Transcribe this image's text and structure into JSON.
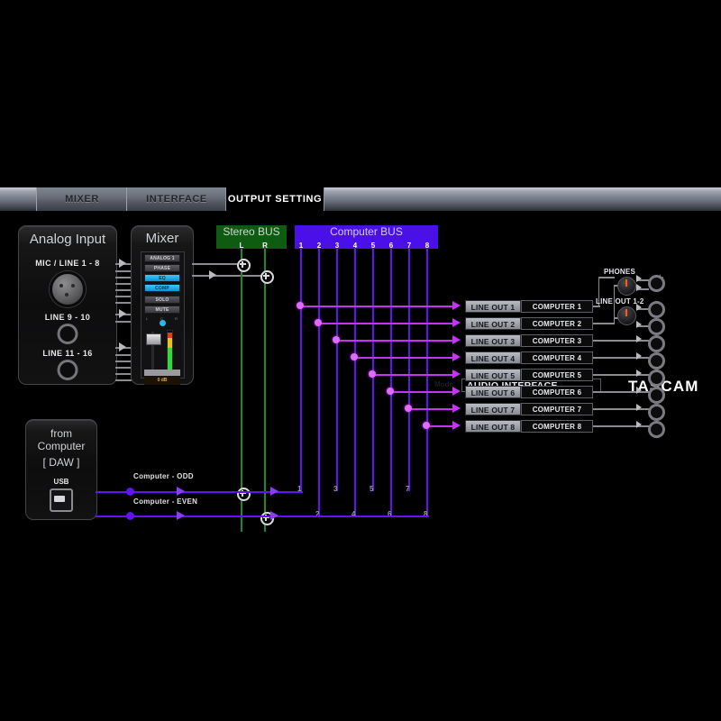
{
  "header": {
    "tabs": [
      {
        "label": "MIXER",
        "active": false
      },
      {
        "label": "INTERFACE",
        "active": false
      },
      {
        "label": "OUTPUT SETTING",
        "active": true
      }
    ],
    "mode_label": "Mode:",
    "mode_value": "AUDIO INTERFACE",
    "brand": "TASCAM"
  },
  "analog_input": {
    "title": "Analog Input",
    "inputs": [
      {
        "label": "MIC / LINE 1 - 8",
        "jack": "xlr-combo-jack"
      },
      {
        "label": "LINE 9 - 10",
        "jack": "trs-jack"
      },
      {
        "label": "LINE 11 - 16",
        "jack": "trs-jack"
      }
    ]
  },
  "mixer": {
    "title": "Mixer",
    "channel_name": "ANALOG 1",
    "buttons": [
      {
        "label": "PHASE",
        "on": false
      },
      {
        "label": "EQ",
        "on": true
      },
      {
        "label": "COMP",
        "on": true
      },
      {
        "label": "SOLO",
        "on": false
      },
      {
        "label": "MUTE",
        "on": false
      }
    ],
    "pan_marks": [
      "L",
      "C",
      "R"
    ],
    "level_readout": "0 dB"
  },
  "from_computer": {
    "line1": "from",
    "line2": "Computer",
    "line3": "[ DAW ]",
    "usb_label": "USB"
  },
  "stereo_bus": {
    "title": "Stereo BUS",
    "channels": [
      "L",
      "R"
    ]
  },
  "computer_bus": {
    "title": "Computer BUS",
    "channels": [
      "1",
      "2",
      "3",
      "4",
      "5",
      "6",
      "7",
      "8"
    ],
    "odd_labels": [
      "1",
      "3",
      "5",
      "7"
    ],
    "even_labels": [
      "2",
      "4",
      "6",
      "8"
    ]
  },
  "daw_streams": [
    {
      "label": "Computer - ODD"
    },
    {
      "label": "Computer - EVEN"
    }
  ],
  "output_rows": [
    {
      "line_out": "LINE OUT 1",
      "source": "COMPUTER 1",
      "bus_tap": 1
    },
    {
      "line_out": "LINE OUT 2",
      "source": "COMPUTER 2",
      "bus_tap": 2
    },
    {
      "line_out": "LINE OUT 3",
      "source": "COMPUTER 3",
      "bus_tap": 3
    },
    {
      "line_out": "LINE OUT 4",
      "source": "COMPUTER 4",
      "bus_tap": 4
    },
    {
      "line_out": "LINE OUT 5",
      "source": "COMPUTER 5",
      "bus_tap": 5
    },
    {
      "line_out": "LINE OUT 6",
      "source": "COMPUTER 6",
      "bus_tap": 6
    },
    {
      "line_out": "LINE OUT 7",
      "source": "COMPUTER 7",
      "bus_tap": 7
    },
    {
      "line_out": "LINE OUT 8",
      "source": "COMPUTER 8",
      "bus_tap": 8
    }
  ],
  "knobs": [
    {
      "label": "PHONES",
      "icon": "headphone-icon"
    },
    {
      "label": "LINE OUT 1-2",
      "icon": ""
    }
  ],
  "colors": {
    "stereo_bus": "#0d5c12",
    "stereo_line": "#1f8a22",
    "computer_bus": "#4b10e8",
    "computer_line": "#6312f0",
    "routing_line": "#c335f0",
    "accent_knob": "#ff5a1e",
    "active_button": "#3fc4ff"
  }
}
